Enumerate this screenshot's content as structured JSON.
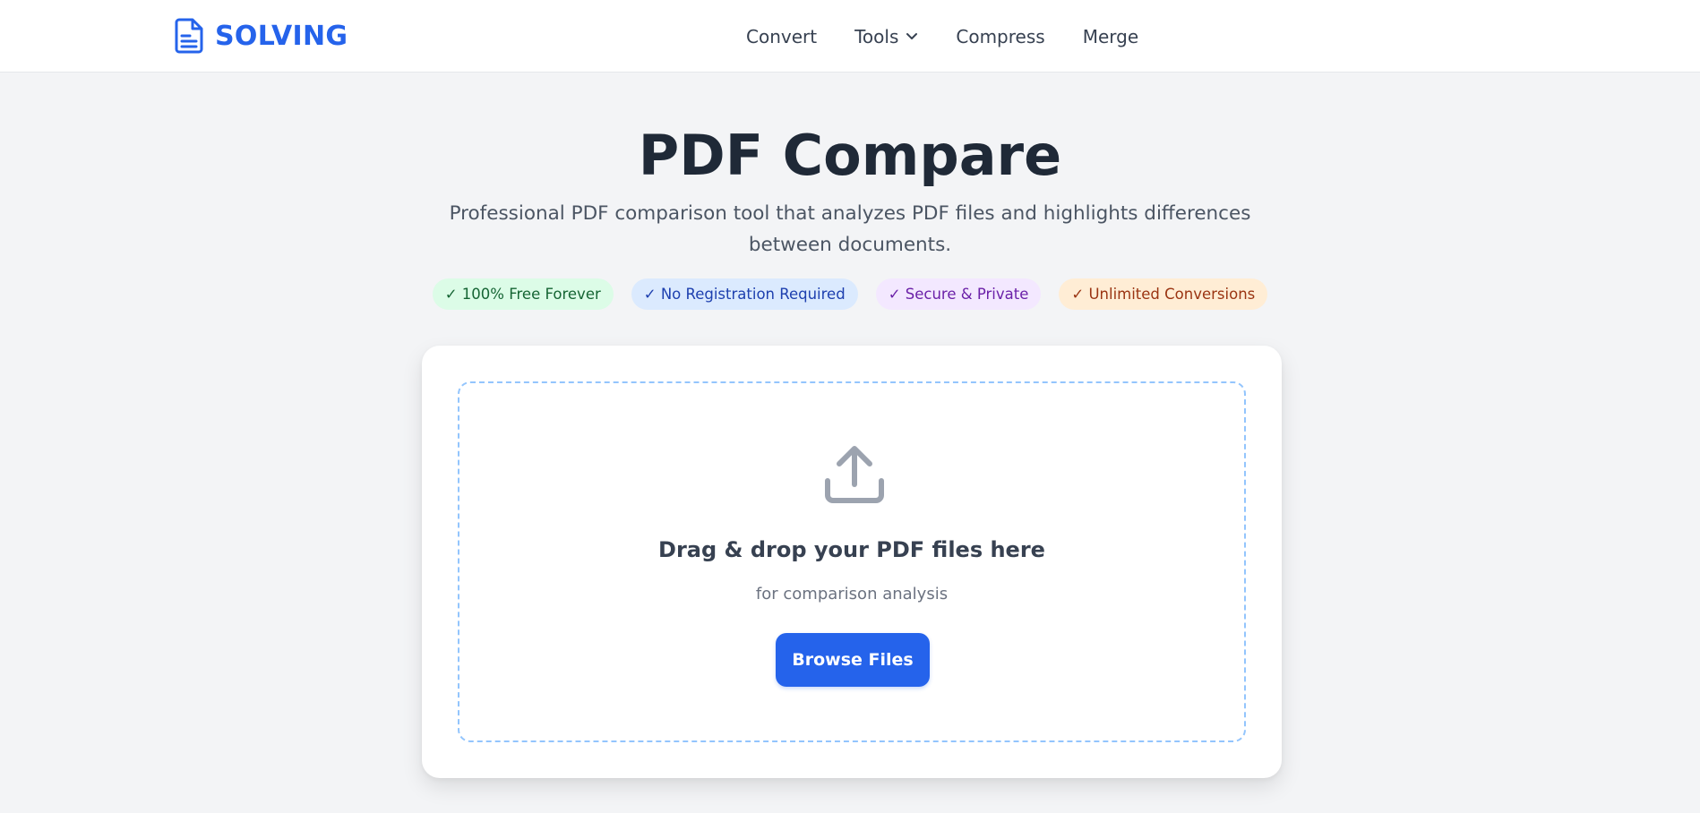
{
  "brand": {
    "name": "SOLVING",
    "color": "#2563eb",
    "icon": "document-icon"
  },
  "nav": {
    "items": [
      {
        "label": "Convert"
      },
      {
        "label": "Tools",
        "has_dropdown": true
      },
      {
        "label": "Compress"
      },
      {
        "label": "Merge"
      }
    ]
  },
  "hero": {
    "title": "PDF Compare",
    "subtitle": "Professional PDF comparison tool that analyzes PDF files and highlights differences between documents."
  },
  "badges": [
    {
      "label": "✓ 100% Free Forever",
      "color": "#166534",
      "bg": "#dcfce7"
    },
    {
      "label": "✓ No Registration Required",
      "color": "#1e40af",
      "bg": "#dbeafe"
    },
    {
      "label": "✓ Secure & Private",
      "color": "#6b21a8",
      "bg": "#f3e8ff"
    },
    {
      "label": "✓ Unlimited Conversions",
      "color": "#9a3412",
      "bg": "#ffedd5"
    }
  ],
  "upload": {
    "icon": "upload-icon",
    "title": "Drag & drop your PDF files here",
    "subtitle": "for comparison analysis",
    "button_label": "Browse Files",
    "button_color": "#2563eb"
  }
}
